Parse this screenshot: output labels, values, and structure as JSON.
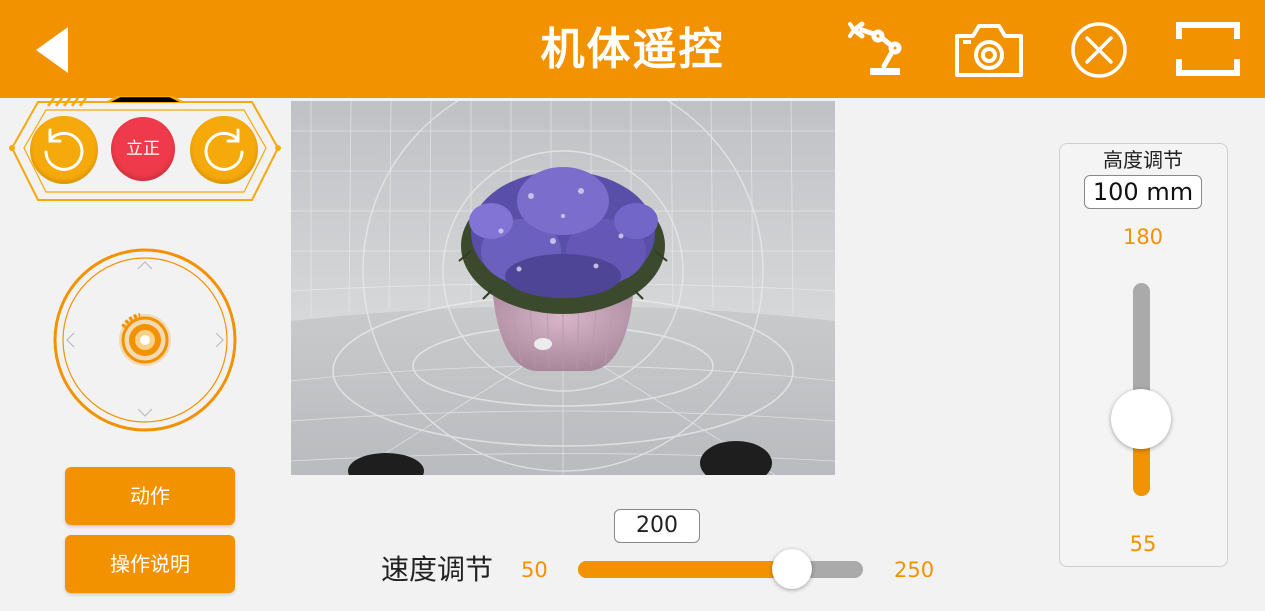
{
  "header": {
    "title": "机体遥控",
    "back_icon": "back-arrow-icon",
    "arm_icon": "robot-arm-icon",
    "camera_icon": "camera-icon",
    "close_icon": "close-circle-icon",
    "fullscreen_icon": "fullscreen-icon"
  },
  "rotation": {
    "stand_label": "立正",
    "rotate_left_icon": "rotate-left-icon",
    "rotate_right_icon": "rotate-right-icon"
  },
  "joystick": {
    "icon": "joystick-knob-icon"
  },
  "buttons": {
    "action": "动作",
    "help": "操作说明"
  },
  "speed": {
    "label": "速度调节",
    "min": "50",
    "max": "250",
    "value": "200",
    "level": 0.75
  },
  "height": {
    "label": "高度调节",
    "value": "100 mm",
    "max": "180",
    "min": "55",
    "level": 0.36
  },
  "colors": {
    "accent": "#f39200",
    "stand": "#ee3a4a",
    "rotate": "#f6a90a",
    "track": "#aaaaaa"
  }
}
